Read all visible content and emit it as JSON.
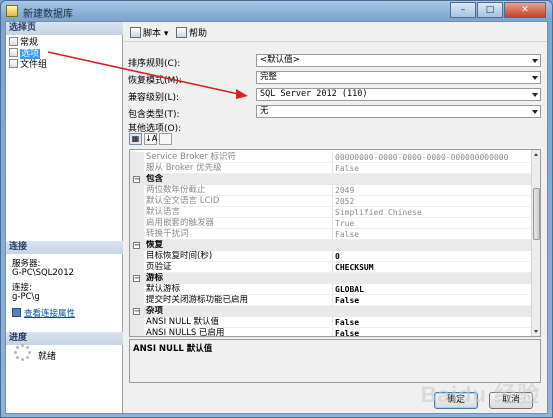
{
  "window": {
    "title": "新建数据库",
    "close_glyph": "✕",
    "min_glyph": "–",
    "max_glyph": "□"
  },
  "left": {
    "select_page_header": "选择页",
    "pages": [
      {
        "label": "常规",
        "selected": false
      },
      {
        "label": "选项",
        "selected": true
      },
      {
        "label": "文件组",
        "selected": false
      }
    ],
    "connection_header": "连接",
    "server_label": "服务器:",
    "server_value": "G-PC\\SQL2012",
    "connection_label": "连接:",
    "connection_value": "g-PC\\g",
    "view_conn_props": "查看连接属性",
    "progress_header": "进度",
    "progress_status": "就绪"
  },
  "toolbar": {
    "script_label": "脚本",
    "script_dropdown": "▾",
    "help_label": "帮助"
  },
  "form": {
    "collation_label": "排序规则(C):",
    "collation_value": "<默认值>",
    "recovery_label": "恢复模式(M):",
    "recovery_value": "完整",
    "compat_label": "兼容级别(L):",
    "compat_value": "SQL Server 2012 (110)",
    "containment_label": "包含类型(T):",
    "containment_value": "无",
    "other_options_label": "其他选项(O):"
  },
  "grid_buttons": [
    "categorized",
    "alphabetical",
    "property-pages"
  ],
  "grid_button_glyphs": [
    "▦",
    "↓A",
    ""
  ],
  "grid": {
    "rows": [
      {
        "type": "prop",
        "style": "gray",
        "name": "Service Broker 标识符",
        "value": "00000000-0000-0000-0000-000000000000"
      },
      {
        "type": "prop",
        "style": "gray",
        "name": " 服从 Broker 优先级",
        "value": "False"
      },
      {
        "type": "cat",
        "name": "包含"
      },
      {
        "type": "prop",
        "style": "gray",
        "name": "两位数年份截止",
        "value": "2049"
      },
      {
        "type": "prop",
        "style": "gray",
        "name": "默认全文语言 LCID",
        "value": "2052"
      },
      {
        "type": "prop",
        "style": "gray",
        "name": "默认语言",
        "value": "Simplified Chinese"
      },
      {
        "type": "prop",
        "style": "gray",
        "name": "启用嵌套的触发器",
        "value": "True"
      },
      {
        "type": "prop",
        "style": "gray",
        "name": "转换干扰词",
        "value": "False"
      },
      {
        "type": "cat",
        "name": "恢复"
      },
      {
        "type": "prop",
        "style": "bold",
        "name": "目标恢复时间(秒)",
        "value": "0"
      },
      {
        "type": "prop",
        "style": "bold",
        "name": "页验证",
        "value": "CHECKSUM"
      },
      {
        "type": "cat",
        "name": "游标"
      },
      {
        "type": "prop",
        "style": "bold",
        "name": "默认游标",
        "value": "GLOBAL"
      },
      {
        "type": "prop",
        "style": "bold",
        "name": "提交时关闭游标功能已启用",
        "value": "False"
      },
      {
        "type": "cat",
        "name": "杂项"
      },
      {
        "type": "prop",
        "style": "bold",
        "name": "ANSI NULL 默认值",
        "value": "False"
      },
      {
        "type": "prop",
        "style": "bold",
        "name": "ANSI NULLS 已启用",
        "value": "False"
      }
    ]
  },
  "description": {
    "text": "ANSI NULL 默认值"
  },
  "buttons": {
    "ok": "确定",
    "cancel": "取消"
  },
  "watermark": "Baidu 经验",
  "colors": {
    "selection": "#3399ff",
    "annotation_arrow": "#d22222",
    "link": "#0645ad"
  }
}
